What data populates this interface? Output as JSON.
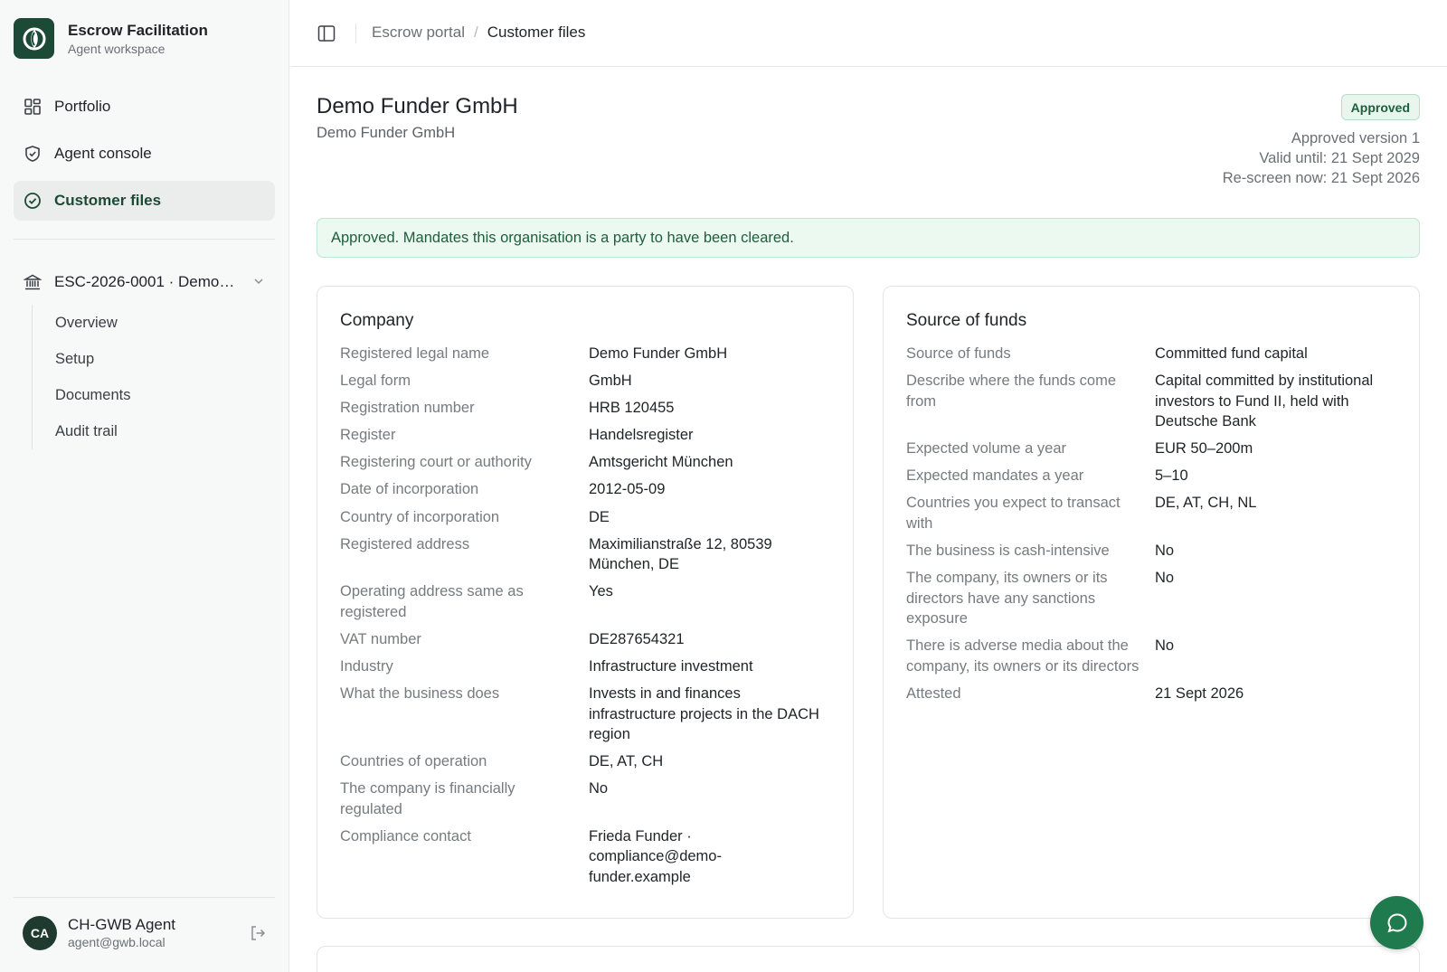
{
  "brand": {
    "title": "Escrow Facilitation",
    "subtitle": "Agent workspace"
  },
  "nav": {
    "items": [
      {
        "label": "Portfolio",
        "icon": "grid-icon"
      },
      {
        "label": "Agent console",
        "icon": "shield-icon"
      },
      {
        "label": "Customer files",
        "icon": "check-circle-icon",
        "active": true
      }
    ]
  },
  "file_select": {
    "label": "ESC-2026-0001 · Demo Funder GmbH",
    "icon": "bank-icon"
  },
  "subnav": {
    "items": [
      "Overview",
      "Setup",
      "Documents",
      "Audit trail"
    ]
  },
  "user": {
    "initials": "CA",
    "name": "CH-GWB Agent",
    "email": "agent@gwb.local"
  },
  "breadcrumb": {
    "root": "Escrow portal",
    "separator": "/",
    "current": "Customer files"
  },
  "header": {
    "title": "Demo Funder GmbH",
    "subtitle": "Demo Funder GmbH",
    "status": "Approved",
    "meta": [
      "Approved version 1",
      "Valid until: 21 Sept 2029",
      "Re-screen now: 21 Sept 2026"
    ]
  },
  "alert": {
    "text": "Approved. Mandates this organisation is a party to have been cleared."
  },
  "company": {
    "title": "Company",
    "rows": [
      {
        "k": "Registered legal name",
        "v": "Demo Funder GmbH"
      },
      {
        "k": "Legal form",
        "v": "GmbH"
      },
      {
        "k": "Registration number",
        "v": "HRB 120455"
      },
      {
        "k": "Register",
        "v": "Handelsregister"
      },
      {
        "k": "Registering court or authority",
        "v": "Amtsgericht München"
      },
      {
        "k": "Date of incorporation",
        "v": "2012-05-09"
      },
      {
        "k": "Country of incorporation",
        "v": "DE"
      },
      {
        "k": "Registered address",
        "v": "Maximilianstraße 12, 80539 München, DE"
      },
      {
        "k": "Operating address same as registered",
        "v": "Yes"
      },
      {
        "k": "VAT number",
        "v": "DE287654321"
      },
      {
        "k": "Industry",
        "v": "Infrastructure investment"
      },
      {
        "k": "What the business does",
        "v": "Invests in and finances infrastructure projects in the DACH region"
      },
      {
        "k": "Countries of operation",
        "v": "DE, AT, CH"
      },
      {
        "k": "The company is financially regulated",
        "v": "No"
      },
      {
        "k": "Compliance contact",
        "v": "Frieda Funder · compliance@demo-funder.example"
      }
    ]
  },
  "funds": {
    "title": "Source of funds",
    "rows": [
      {
        "k": "Source of funds",
        "v": "Committed fund capital"
      },
      {
        "k": "Describe where the funds come from",
        "v": "Capital committed by institutional investors to Fund II, held with Deutsche Bank"
      },
      {
        "k": "Expected volume a year",
        "v": "EUR 50–200m"
      },
      {
        "k": "Expected mandates a year",
        "v": "5–10"
      },
      {
        "k": "Countries you expect to transact with",
        "v": "DE, AT, CH, NL"
      },
      {
        "k": "The business is cash-intensive",
        "v": "No"
      },
      {
        "k": "The company, its owners or its directors have any sanctions exposure",
        "v": "No"
      },
      {
        "k": "There is adverse media about the company, its owners or its directors",
        "v": "No"
      },
      {
        "k": "Attested",
        "v": "21 Sept 2026"
      }
    ]
  },
  "colors": {
    "brand": "#1d4a37",
    "accent": "#1f7a4d",
    "success_bg": "#ecf9f1"
  },
  "chat": {
    "icon": "chat-bubble-icon"
  }
}
